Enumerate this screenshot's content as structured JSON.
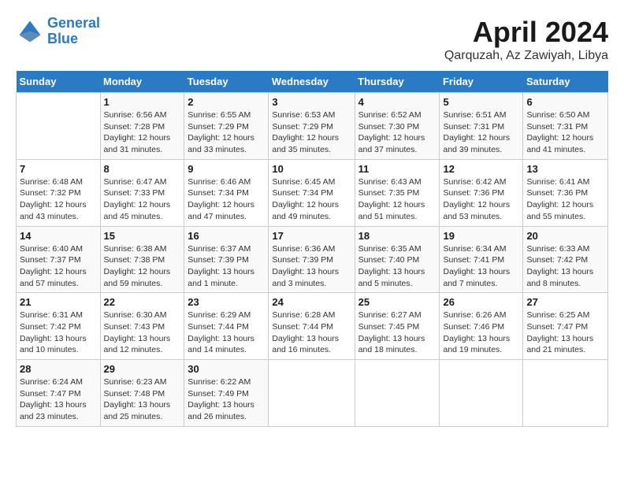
{
  "logo": {
    "line1": "General",
    "line2": "Blue"
  },
  "title": "April 2024",
  "subtitle": "Qarquzah, Az Zawiyah, Libya",
  "header": {
    "accent_color": "#2b7bc4"
  },
  "weekdays": [
    "Sunday",
    "Monday",
    "Tuesday",
    "Wednesday",
    "Thursday",
    "Friday",
    "Saturday"
  ],
  "weeks": [
    [
      {
        "day": "",
        "sunrise": "",
        "sunset": "",
        "daylight": ""
      },
      {
        "day": "1",
        "sunrise": "Sunrise: 6:56 AM",
        "sunset": "Sunset: 7:28 PM",
        "daylight": "Daylight: 12 hours and 31 minutes."
      },
      {
        "day": "2",
        "sunrise": "Sunrise: 6:55 AM",
        "sunset": "Sunset: 7:29 PM",
        "daylight": "Daylight: 12 hours and 33 minutes."
      },
      {
        "day": "3",
        "sunrise": "Sunrise: 6:53 AM",
        "sunset": "Sunset: 7:29 PM",
        "daylight": "Daylight: 12 hours and 35 minutes."
      },
      {
        "day": "4",
        "sunrise": "Sunrise: 6:52 AM",
        "sunset": "Sunset: 7:30 PM",
        "daylight": "Daylight: 12 hours and 37 minutes."
      },
      {
        "day": "5",
        "sunrise": "Sunrise: 6:51 AM",
        "sunset": "Sunset: 7:31 PM",
        "daylight": "Daylight: 12 hours and 39 minutes."
      },
      {
        "day": "6",
        "sunrise": "Sunrise: 6:50 AM",
        "sunset": "Sunset: 7:31 PM",
        "daylight": "Daylight: 12 hours and 41 minutes."
      }
    ],
    [
      {
        "day": "7",
        "sunrise": "Sunrise: 6:48 AM",
        "sunset": "Sunset: 7:32 PM",
        "daylight": "Daylight: 12 hours and 43 minutes."
      },
      {
        "day": "8",
        "sunrise": "Sunrise: 6:47 AM",
        "sunset": "Sunset: 7:33 PM",
        "daylight": "Daylight: 12 hours and 45 minutes."
      },
      {
        "day": "9",
        "sunrise": "Sunrise: 6:46 AM",
        "sunset": "Sunset: 7:34 PM",
        "daylight": "Daylight: 12 hours and 47 minutes."
      },
      {
        "day": "10",
        "sunrise": "Sunrise: 6:45 AM",
        "sunset": "Sunset: 7:34 PM",
        "daylight": "Daylight: 12 hours and 49 minutes."
      },
      {
        "day": "11",
        "sunrise": "Sunrise: 6:43 AM",
        "sunset": "Sunset: 7:35 PM",
        "daylight": "Daylight: 12 hours and 51 minutes."
      },
      {
        "day": "12",
        "sunrise": "Sunrise: 6:42 AM",
        "sunset": "Sunset: 7:36 PM",
        "daylight": "Daylight: 12 hours and 53 minutes."
      },
      {
        "day": "13",
        "sunrise": "Sunrise: 6:41 AM",
        "sunset": "Sunset: 7:36 PM",
        "daylight": "Daylight: 12 hours and 55 minutes."
      }
    ],
    [
      {
        "day": "14",
        "sunrise": "Sunrise: 6:40 AM",
        "sunset": "Sunset: 7:37 PM",
        "daylight": "Daylight: 12 hours and 57 minutes."
      },
      {
        "day": "15",
        "sunrise": "Sunrise: 6:38 AM",
        "sunset": "Sunset: 7:38 PM",
        "daylight": "Daylight: 12 hours and 59 minutes."
      },
      {
        "day": "16",
        "sunrise": "Sunrise: 6:37 AM",
        "sunset": "Sunset: 7:39 PM",
        "daylight": "Daylight: 13 hours and 1 minute."
      },
      {
        "day": "17",
        "sunrise": "Sunrise: 6:36 AM",
        "sunset": "Sunset: 7:39 PM",
        "daylight": "Daylight: 13 hours and 3 minutes."
      },
      {
        "day": "18",
        "sunrise": "Sunrise: 6:35 AM",
        "sunset": "Sunset: 7:40 PM",
        "daylight": "Daylight: 13 hours and 5 minutes."
      },
      {
        "day": "19",
        "sunrise": "Sunrise: 6:34 AM",
        "sunset": "Sunset: 7:41 PM",
        "daylight": "Daylight: 13 hours and 7 minutes."
      },
      {
        "day": "20",
        "sunrise": "Sunrise: 6:33 AM",
        "sunset": "Sunset: 7:42 PM",
        "daylight": "Daylight: 13 hours and 8 minutes."
      }
    ],
    [
      {
        "day": "21",
        "sunrise": "Sunrise: 6:31 AM",
        "sunset": "Sunset: 7:42 PM",
        "daylight": "Daylight: 13 hours and 10 minutes."
      },
      {
        "day": "22",
        "sunrise": "Sunrise: 6:30 AM",
        "sunset": "Sunset: 7:43 PM",
        "daylight": "Daylight: 13 hours and 12 minutes."
      },
      {
        "day": "23",
        "sunrise": "Sunrise: 6:29 AM",
        "sunset": "Sunset: 7:44 PM",
        "daylight": "Daylight: 13 hours and 14 minutes."
      },
      {
        "day": "24",
        "sunrise": "Sunrise: 6:28 AM",
        "sunset": "Sunset: 7:44 PM",
        "daylight": "Daylight: 13 hours and 16 minutes."
      },
      {
        "day": "25",
        "sunrise": "Sunrise: 6:27 AM",
        "sunset": "Sunset: 7:45 PM",
        "daylight": "Daylight: 13 hours and 18 minutes."
      },
      {
        "day": "26",
        "sunrise": "Sunrise: 6:26 AM",
        "sunset": "Sunset: 7:46 PM",
        "daylight": "Daylight: 13 hours and 19 minutes."
      },
      {
        "day": "27",
        "sunrise": "Sunrise: 6:25 AM",
        "sunset": "Sunset: 7:47 PM",
        "daylight": "Daylight: 13 hours and 21 minutes."
      }
    ],
    [
      {
        "day": "28",
        "sunrise": "Sunrise: 6:24 AM",
        "sunset": "Sunset: 7:47 PM",
        "daylight": "Daylight: 13 hours and 23 minutes."
      },
      {
        "day": "29",
        "sunrise": "Sunrise: 6:23 AM",
        "sunset": "Sunset: 7:48 PM",
        "daylight": "Daylight: 13 hours and 25 minutes."
      },
      {
        "day": "30",
        "sunrise": "Sunrise: 6:22 AM",
        "sunset": "Sunset: 7:49 PM",
        "daylight": "Daylight: 13 hours and 26 minutes."
      },
      {
        "day": "",
        "sunrise": "",
        "sunset": "",
        "daylight": ""
      },
      {
        "day": "",
        "sunrise": "",
        "sunset": "",
        "daylight": ""
      },
      {
        "day": "",
        "sunrise": "",
        "sunset": "",
        "daylight": ""
      },
      {
        "day": "",
        "sunrise": "",
        "sunset": "",
        "daylight": ""
      }
    ]
  ]
}
